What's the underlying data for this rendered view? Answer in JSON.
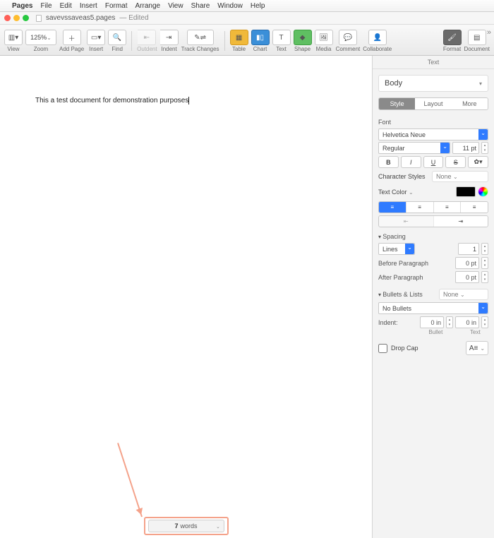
{
  "menubar": {
    "app": "Pages",
    "items": [
      "File",
      "Edit",
      "Insert",
      "Format",
      "Arrange",
      "View",
      "Share",
      "Window",
      "Help"
    ]
  },
  "titlebar": {
    "filename": "savevssaveas5.pages",
    "status": "— Edited"
  },
  "toolbar": {
    "view": "View",
    "zoom_value": "125%",
    "zoom": "Zoom",
    "add_page": "Add Page",
    "insert": "Insert",
    "find": "Find",
    "outdent": "Outdent",
    "indent": "Indent",
    "track": "Track Changes",
    "table": "Table",
    "chart": "Chart",
    "text": "Text",
    "shape": "Shape",
    "media": "Media",
    "comment": "Comment",
    "collab": "Collaborate",
    "format": "Format",
    "document": "Document"
  },
  "document": {
    "body_text": "This a test document for demonstration purposes"
  },
  "wordcount": {
    "count": "7",
    "label": "words"
  },
  "inspector": {
    "tab_label": "Text",
    "paragraph_style": "Body",
    "segments": {
      "style": "Style",
      "layout": "Layout",
      "more": "More"
    },
    "font": {
      "label": "Font",
      "family": "Helvetica Neue",
      "weight": "Regular",
      "size": "11 pt",
      "b": "B",
      "i": "I",
      "u": "U",
      "s": "S",
      "gear": "✿▾"
    },
    "char_styles": {
      "label": "Character Styles",
      "value": "None"
    },
    "text_color": {
      "label": "Text Color",
      "hex": "#000000"
    },
    "spacing": {
      "label": "Spacing",
      "mode": "Lines",
      "value": "1",
      "before_label": "Before Paragraph",
      "before": "0 pt",
      "after_label": "After Paragraph",
      "after": "0 pt"
    },
    "bullets": {
      "label": "Bullets & Lists",
      "preset": "None",
      "style": "No Bullets",
      "indent_label": "Indent:",
      "bullet_indent": "0 in",
      "text_indent": "0 in",
      "bullet_caption": "Bullet",
      "text_caption": "Text"
    },
    "dropcap": {
      "label": "Drop Cap",
      "preview": "A≡"
    }
  }
}
